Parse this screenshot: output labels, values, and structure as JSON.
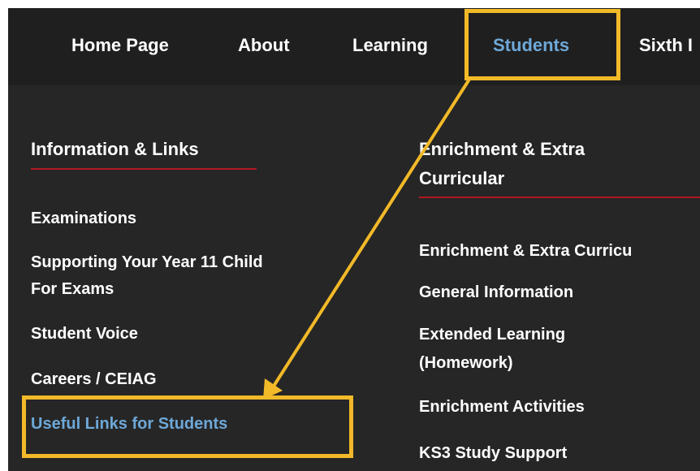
{
  "nav": {
    "items": [
      {
        "label": "Home Page"
      },
      {
        "label": "About"
      },
      {
        "label": "Learning"
      },
      {
        "label": "Students"
      },
      {
        "label": "Sixth I"
      }
    ]
  },
  "menu": {
    "col1": {
      "heading": "Information & Links",
      "links": [
        {
          "label": "Examinations"
        },
        {
          "label": "Supporting Your Year 11 Child"
        },
        {
          "label": "For Exams"
        },
        {
          "label": "Student Voice"
        },
        {
          "label": "Careers / CEIAG"
        },
        {
          "label": "Useful Links for Students"
        }
      ]
    },
    "col2": {
      "heading_line1": "Enrichment & Extra",
      "heading_line2": "Curricular",
      "links": [
        {
          "label": "Enrichment & Extra Curricu"
        },
        {
          "label": "General Information"
        },
        {
          "label": "Extended Learning"
        },
        {
          "label": "(Homework)"
        },
        {
          "label": "Enrichment Activities"
        },
        {
          "label": "KS3 Study Support"
        }
      ]
    }
  },
  "colors": {
    "nav_background": "#1f1f1f",
    "menu_background": "#262626",
    "active_link": "#6ea8d8",
    "heading_underline": "#b01822",
    "annotation": "#f2b928"
  }
}
